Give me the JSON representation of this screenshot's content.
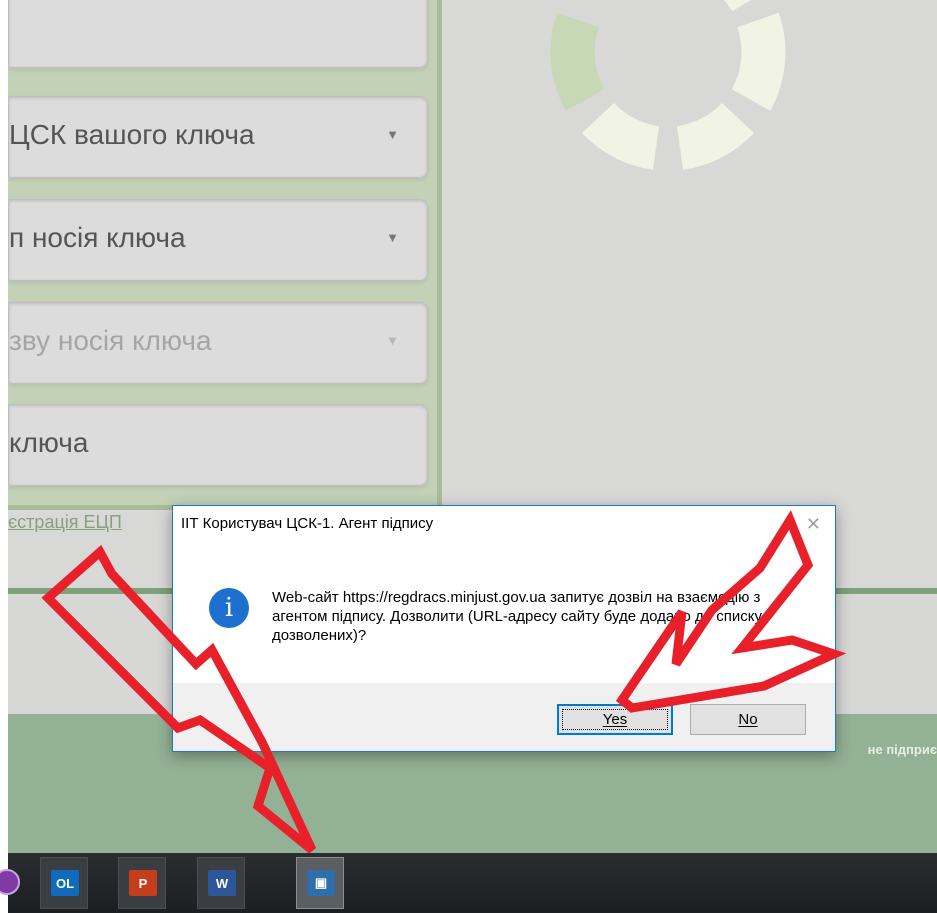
{
  "page": {
    "fields": [
      {
        "text": "",
        "has_caret": false
      },
      {
        "text": "ЦСК вашого ключа",
        "has_caret": true
      },
      {
        "text": "п носія ключа",
        "has_caret": true
      },
      {
        "text": "зву носія ключа",
        "has_caret": true
      },
      {
        "text": "ключа",
        "has_caret": false
      }
    ],
    "link_text": "єстрація ЕЦП",
    "footer_text": "не підприє",
    "caret_glyph": "▼"
  },
  "dialog": {
    "title": "ІІТ Користувач ЦСК-1. Агент підпису",
    "close_glyph": "✕",
    "icon_glyph": "i",
    "message": "Web-сайт https://regdracs.minjust.gov.ua запитує дозвіл на взаємодію з агентом підпису. Дозволити (URL-адресу сайту буде додано до списку дозволених)?",
    "yes_label": "Yes",
    "no_label": "No"
  },
  "taskbar": {
    "apps": [
      {
        "name": "outlook",
        "glyph": "OL",
        "color": "#0f6cbd"
      },
      {
        "name": "powerpoint",
        "glyph": "P",
        "color": "#c43e1c"
      },
      {
        "name": "word",
        "glyph": "W",
        "color": "#2b579a"
      },
      {
        "name": "signature-agent",
        "glyph": "▣",
        "color": "#2d6fa8"
      }
    ]
  },
  "colors": {
    "arrow": "#e8202a",
    "dialog_border": "#1979ca",
    "info_icon": "#1f6fd0",
    "footer": "#93b195",
    "left_panel": "#c3d1b7"
  }
}
